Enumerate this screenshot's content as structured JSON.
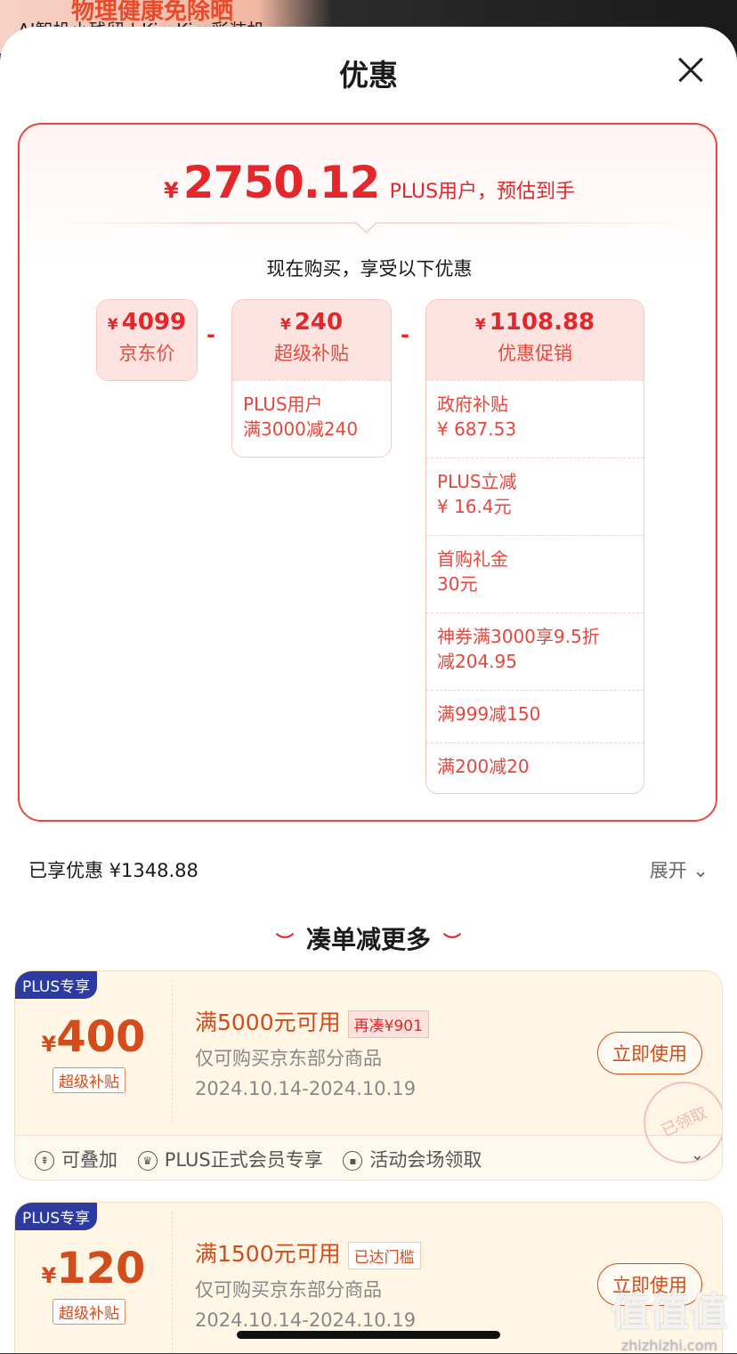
{
  "background": {
    "line1": "物理健康免除晒",
    "line2": "AI智投小残留 | KiraKira彩装机"
  },
  "sheet": {
    "title": "优惠"
  },
  "summary": {
    "currency": "¥",
    "price": "2750.12",
    "suffix": "PLUS用户，预估到手",
    "subhead": "现在购买，享受以下优惠"
  },
  "breakdown": {
    "jd": {
      "amount": "4099",
      "label": "京东价"
    },
    "subsidy": {
      "amount": "240",
      "label": "超级补贴",
      "items": [
        "PLUS用户\n满3000减240"
      ]
    },
    "promo": {
      "amount": "1108.88",
      "label": "优惠促销",
      "items": [
        "政府补贴\n¥ 687.53",
        "PLUS立减\n¥ 16.4元",
        "首购礼金\n30元",
        "神券满3000享9.5折\n减204.95",
        "满999减150",
        "满200减20"
      ]
    },
    "minus": "-"
  },
  "saved": {
    "text": "已享优惠 ¥1348.88",
    "expand": "展开"
  },
  "section": {
    "title": "凑单减更多",
    "ornament": "︶"
  },
  "coupons": [
    {
      "badge": "PLUS专享",
      "currency": "¥",
      "amount": "400",
      "tag": "超级补贴",
      "condition": "满5000元可用",
      "pill": "再凑¥901",
      "desc": "仅可购买京东部分商品",
      "date": "2024.10.14-2024.10.19",
      "button": "立即使用",
      "stamp": "已领取",
      "footer": [
        "可叠加",
        "PLUS正式会员专享",
        "活动会场领取"
      ]
    },
    {
      "badge": "PLUS专享",
      "currency": "¥",
      "amount": "120",
      "tag": "超级补贴",
      "condition": "满1500元可用",
      "pill": "已达门槛",
      "desc": "仅可购买京东部分商品",
      "date": "2024.10.14-2024.10.19",
      "button": "立即使用"
    }
  ],
  "watermark": {
    "text": "值值值",
    "url": "zhizhizhi.com"
  }
}
